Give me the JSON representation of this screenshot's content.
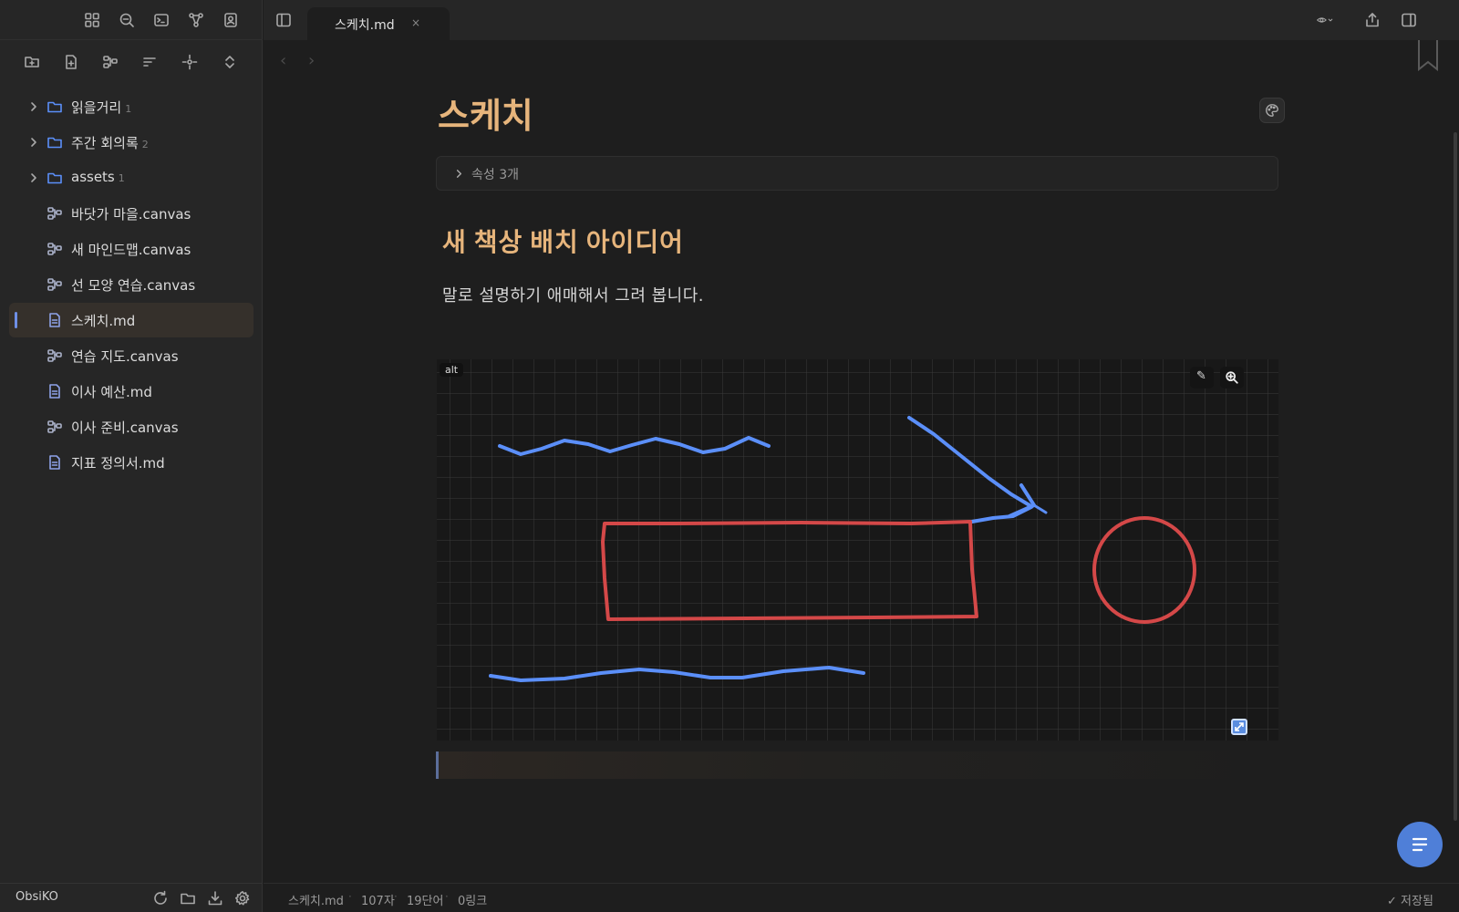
{
  "colors": {
    "accent": "#e7b57c",
    "folder_icon": "#5b8ff9",
    "sketch_blue": "#5b8ff9",
    "sketch_red": "#d44848"
  },
  "sidebar": {
    "ribbon_icons": [
      "layout-grid-icon",
      "search-icon",
      "terminal-icon",
      "graph-icon",
      "contacts-icon"
    ],
    "toolbar_icons": [
      "new-folder-icon",
      "new-note-icon",
      "new-canvas-icon",
      "sort-icon",
      "reveal-active-icon",
      "collapse-icon"
    ],
    "items": [
      {
        "type": "folder",
        "label": "읽을거리",
        "count": "1"
      },
      {
        "type": "folder",
        "label": "주간 회의록",
        "count": "2"
      },
      {
        "type": "folder",
        "label": "assets",
        "count": "1"
      },
      {
        "type": "canvas",
        "label": "바닷가 마을.canvas"
      },
      {
        "type": "canvas",
        "label": "새 마인드맵.canvas"
      },
      {
        "type": "canvas",
        "label": "선 모양 연습.canvas"
      },
      {
        "type": "doc",
        "label": "스케치.md",
        "active": true
      },
      {
        "type": "canvas",
        "label": "연습 지도.canvas"
      },
      {
        "type": "doc",
        "label": "이사 예산.md"
      },
      {
        "type": "canvas",
        "label": "이사 준비.canvas"
      },
      {
        "type": "doc",
        "label": "지표 정의서.md"
      }
    ],
    "vault_name": "ObsiKO"
  },
  "tab": {
    "title": "스케치.md",
    "close": "×"
  },
  "nav": {
    "back": "‹",
    "forward": "›"
  },
  "note": {
    "title": "스케치",
    "properties_label": "속성  3개",
    "heading": "새 책상 배치 아이디어",
    "paragraph": "말로 설명하기 애매해서 그려 봅니다."
  },
  "sketch": {
    "alt_label": "alt",
    "edit_icon": "✎"
  },
  "statusbar": {
    "filename": "스케치.md",
    "chars": "107자",
    "words": "19단어",
    "links": "0링크",
    "saved": "✓ 저장됨"
  }
}
